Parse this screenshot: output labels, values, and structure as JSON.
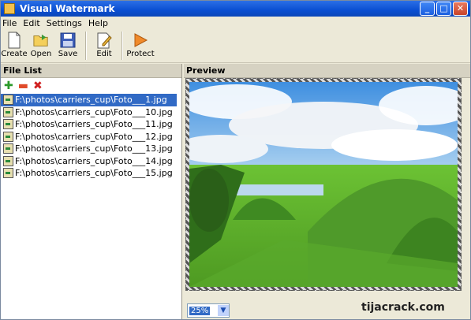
{
  "app": {
    "title": "Visual Watermark"
  },
  "menu": [
    "File",
    "Edit",
    "Settings",
    "Help"
  ],
  "toolbar": {
    "create_label": "Create",
    "open_label": "Open",
    "save_label": "Save",
    "edit_label": "Edit",
    "protect_label": "Protect"
  },
  "file_list": {
    "title": "File List",
    "icons": [
      "add-icon",
      "remove-icon",
      "delete-icon"
    ],
    "files": [
      "F:\\photos\\carriers_cup\\Foto___1.jpg",
      "F:\\photos\\carriers_cup\\Foto___10.jpg",
      "F:\\photos\\carriers_cup\\Foto___11.jpg",
      "F:\\photos\\carriers_cup\\Foto___12.jpg",
      "F:\\photos\\carriers_cup\\Foto___13.jpg",
      "F:\\photos\\carriers_cup\\Foto___14.jpg",
      "F:\\photos\\carriers_cup\\Foto___15.jpg"
    ],
    "selected_index": 0
  },
  "preview": {
    "title": "Preview",
    "zoom": "25%"
  },
  "watermark_text": "tijacrack.com",
  "colors": {
    "accent": "#316ac5",
    "titlebar": "#0a4fd2",
    "sky": "#5aa3e6",
    "grass": "#5fae2c"
  }
}
